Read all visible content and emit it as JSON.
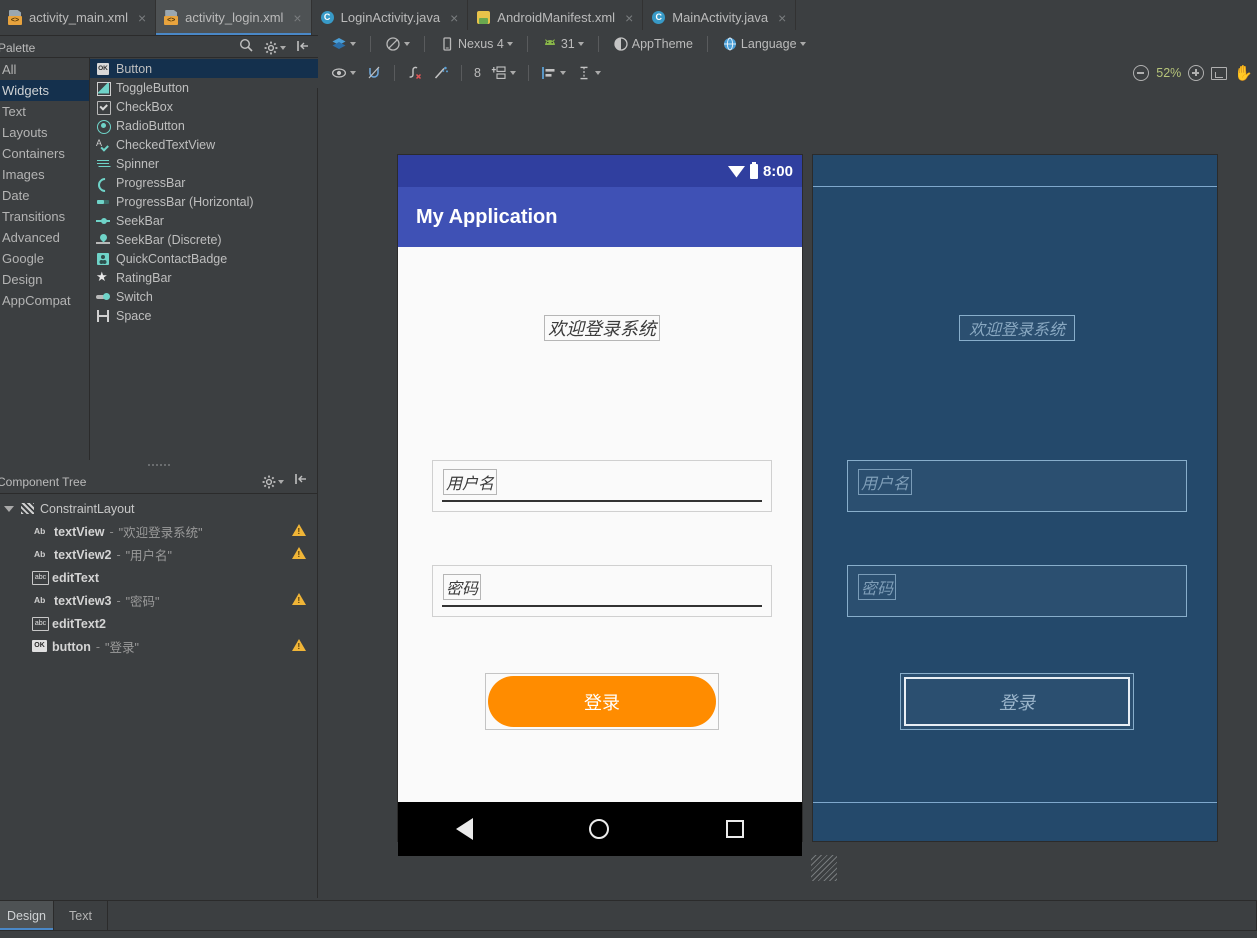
{
  "editor_tabs": [
    {
      "label": "activity_main.xml",
      "icon": "xml-file-icon",
      "active": false,
      "close": "×"
    },
    {
      "label": "activity_login.xml",
      "icon": "xml-file-icon",
      "active": true,
      "close": "×"
    },
    {
      "label": "LoginActivity.java",
      "icon": "java-class-icon",
      "active": false,
      "close": "×"
    },
    {
      "label": "AndroidManifest.xml",
      "icon": "android-manifest-icon",
      "active": false,
      "close": "×"
    },
    {
      "label": "MainActivity.java",
      "icon": "java-class-icon",
      "active": false,
      "close": "×"
    }
  ],
  "palette": {
    "title": "Palette",
    "search_icon": "search-icon",
    "settings_icon": "gear-icon",
    "collapse_icon": "collapse-all-icon",
    "categories": [
      {
        "label": "All",
        "selected": false
      },
      {
        "label": "Widgets",
        "selected": true
      },
      {
        "label": "Text",
        "selected": false
      },
      {
        "label": "Layouts",
        "selected": false
      },
      {
        "label": "Containers",
        "selected": false
      },
      {
        "label": "Images",
        "selected": false
      },
      {
        "label": "Date",
        "selected": false
      },
      {
        "label": "Transitions",
        "selected": false
      },
      {
        "label": "Advanced",
        "selected": false
      },
      {
        "label": "Google",
        "selected": false
      },
      {
        "label": "Design",
        "selected": false
      },
      {
        "label": "AppCompat",
        "selected": false
      }
    ],
    "items": [
      {
        "label": "Button",
        "icon": "btn",
        "selected": true
      },
      {
        "label": "ToggleButton",
        "icon": "toggle",
        "selected": false
      },
      {
        "label": "CheckBox",
        "icon": "check",
        "selected": false
      },
      {
        "label": "RadioButton",
        "icon": "radio",
        "selected": false
      },
      {
        "label": "CheckedTextView",
        "icon": "ctv",
        "selected": false
      },
      {
        "label": "Spinner",
        "icon": "spin",
        "selected": false
      },
      {
        "label": "ProgressBar",
        "icon": "prog",
        "selected": false
      },
      {
        "label": "ProgressBar (Horizontal)",
        "icon": "progh",
        "selected": false
      },
      {
        "label": "SeekBar",
        "icon": "seek",
        "selected": false
      },
      {
        "label": "SeekBar (Discrete)",
        "icon": "seekd",
        "selected": false
      },
      {
        "label": "QuickContactBadge",
        "icon": "qcb",
        "selected": false
      },
      {
        "label": "RatingBar",
        "icon": "star",
        "selected": false
      },
      {
        "label": "Switch",
        "icon": "switch",
        "selected": false
      },
      {
        "label": "Space",
        "icon": "space",
        "selected": false
      }
    ]
  },
  "design_toolbar": {
    "layout_mode_icon": "design-surface-icon",
    "orientation_icon": "orientation-icon",
    "device_icon": "phone-icon",
    "device": "Nexus 4",
    "api_icon": "android-icon",
    "api_level": "31",
    "theme_icon": "theme-icon",
    "theme": "AppTheme",
    "locale_icon": "globe-icon",
    "locale": "Language",
    "eye_icon": "visibility-icon",
    "magnet_icon": "autoconnect-off-icon",
    "clear_constraints_icon": "clear-constraints-icon",
    "infer_constraints_icon": "infer-constraints-icon",
    "margin_value": "8",
    "pack_icon": "pack-icon",
    "align_icon": "align-icon",
    "guidelines_icon": "guidelines-icon",
    "zoom_out_icon": "zoom-out-icon",
    "zoom_level": "52%",
    "zoom_in_icon": "zoom-in-icon",
    "zoom_fit_icon": "zoom-to-fit-icon",
    "pan_icon": "pan-hand-icon"
  },
  "component_tree": {
    "title": "Component Tree",
    "settings_icon": "gear-icon",
    "collapse_icon": "collapse-all-icon",
    "root": {
      "label": "ConstraintLayout",
      "icon": "cl"
    },
    "nodes": [
      {
        "name": "textView",
        "icon": "ab",
        "dash": "-",
        "value": "\"欢迎登录系统\"",
        "warning": true
      },
      {
        "name": "textView2",
        "icon": "ab",
        "dash": "-",
        "value": "\"用户名\"",
        "warning": true
      },
      {
        "name": "editText",
        "icon": "abc",
        "dash": "",
        "value": "",
        "warning": false
      },
      {
        "name": "textView3",
        "icon": "ab",
        "dash": "-",
        "value": "\"密码\"",
        "warning": true
      },
      {
        "name": "editText2",
        "icon": "abc",
        "dash": "",
        "value": "",
        "warning": false
      },
      {
        "name": "button",
        "icon": "okb",
        "dash": "-",
        "value": "\"登录\"",
        "warning": true
      }
    ]
  },
  "preview": {
    "status_time": "8:00",
    "wifi_icon": "wifi-icon",
    "battery_icon": "battery-icon",
    "app_title": "My Application",
    "heading": "欢迎登录系统",
    "username_label": "用户名",
    "password_label": "密码",
    "login_button": "登录",
    "nav_back_icon": "nav-back-icon",
    "nav_home_icon": "nav-home-icon",
    "nav_recents_icon": "nav-recents-icon",
    "colors": {
      "status_bar": "#303f9f",
      "app_bar": "#3f51b5",
      "button": "#ff8c00",
      "blueprint_bg": "#24496b",
      "blueprint_stroke": "#88aecb"
    }
  },
  "bottom_tabs": [
    {
      "label": "Design",
      "active": true
    },
    {
      "label": "Text",
      "active": false
    }
  ]
}
